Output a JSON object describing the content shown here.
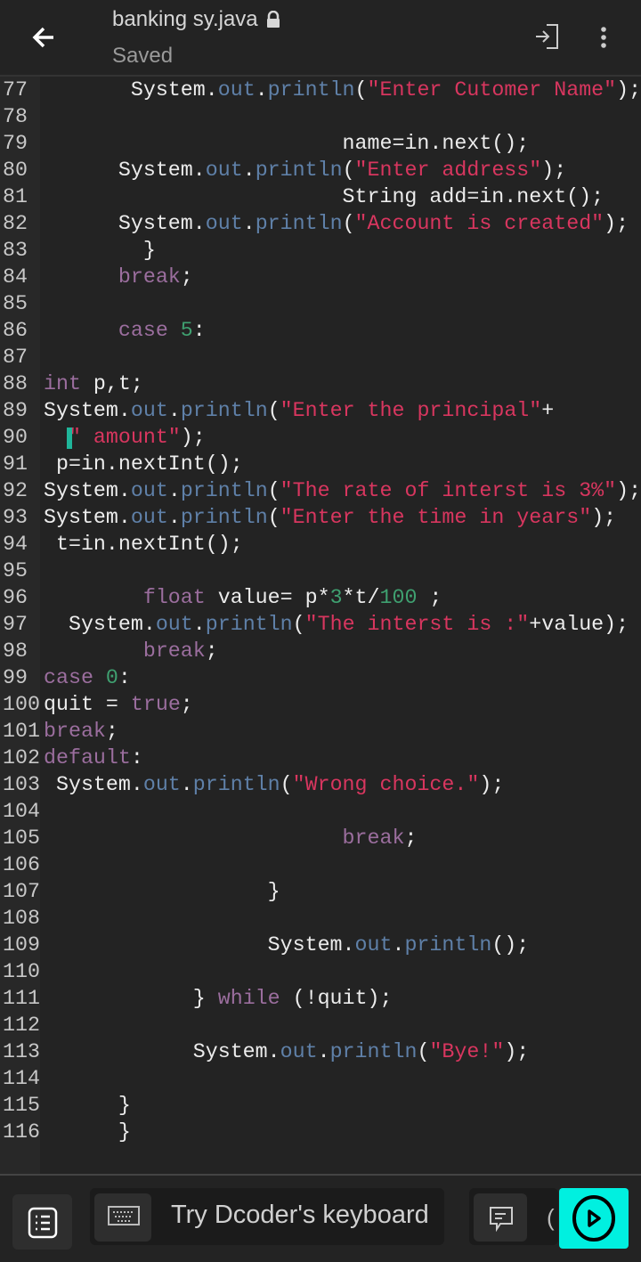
{
  "header": {
    "title": "banking  sy.java",
    "status": "Saved",
    "icons": [
      "back-arrow-icon",
      "lock-icon",
      "exit-icon",
      "more-vert-icon"
    ]
  },
  "colors": {
    "keyword": "#9b6e9e",
    "member": "#5f80a8",
    "string": "#d8365f",
    "number": "#3fa070",
    "run_button": "#00f0e0"
  },
  "editor": {
    "lines": [
      {
        "n": "77",
        "t": [
          [
            "p",
            "       System."
          ],
          [
            "m",
            "out"
          ],
          [
            "p",
            "."
          ],
          [
            "m",
            "println"
          ],
          [
            "p",
            "("
          ],
          [
            "s",
            "\"Enter Cutomer Name\""
          ],
          [
            "p",
            ");"
          ]
        ]
      },
      {
        "n": "78",
        "t": []
      },
      {
        "n": "79",
        "t": [
          [
            "p",
            "                        name=in.next();"
          ]
        ]
      },
      {
        "n": "80",
        "t": [
          [
            "p",
            "      System."
          ],
          [
            "m",
            "out"
          ],
          [
            "p",
            "."
          ],
          [
            "m",
            "println"
          ],
          [
            "p",
            "("
          ],
          [
            "s",
            "\"Enter address\""
          ],
          [
            "p",
            ");"
          ]
        ]
      },
      {
        "n": "81",
        "t": [
          [
            "p",
            "                        String add=in.next();"
          ]
        ]
      },
      {
        "n": "82",
        "t": [
          [
            "p",
            "      System."
          ],
          [
            "m",
            "out"
          ],
          [
            "p",
            "."
          ],
          [
            "m",
            "println"
          ],
          [
            "p",
            "("
          ],
          [
            "s",
            "\"Account is created\""
          ],
          [
            "p",
            ");"
          ]
        ]
      },
      {
        "n": "83",
        "t": [
          [
            "p",
            "        }"
          ]
        ]
      },
      {
        "n": "84",
        "t": [
          [
            "k",
            "      break"
          ],
          [
            "p",
            ";"
          ]
        ]
      },
      {
        "n": "85",
        "t": []
      },
      {
        "n": "86",
        "t": [
          [
            "k",
            "      case "
          ],
          [
            "n",
            "5"
          ],
          [
            "p",
            ":"
          ]
        ]
      },
      {
        "n": "87",
        "t": []
      },
      {
        "n": "88",
        "t": [
          [
            "k",
            "int"
          ],
          [
            "p",
            " p,t;"
          ]
        ]
      },
      {
        "n": "89",
        "t": [
          [
            "p",
            "System."
          ],
          [
            "m",
            "out"
          ],
          [
            "p",
            "."
          ],
          [
            "m",
            "println"
          ],
          [
            "p",
            "("
          ],
          [
            "s",
            "\"Enter the principal\""
          ],
          [
            "p",
            "+"
          ]
        ]
      },
      {
        "n": "90",
        "t": [
          [
            "s",
            "  \" amount\""
          ],
          [
            "p",
            ");"
          ]
        ],
        "cursor": true
      },
      {
        "n": "91",
        "t": [
          [
            "p",
            " p=in.nextInt();"
          ]
        ]
      },
      {
        "n": "92",
        "t": [
          [
            "p",
            "System."
          ],
          [
            "m",
            "out"
          ],
          [
            "p",
            "."
          ],
          [
            "m",
            "println"
          ],
          [
            "p",
            "("
          ],
          [
            "s",
            "\"The rate of interst is 3%\""
          ],
          [
            "p",
            ");"
          ]
        ]
      },
      {
        "n": "93",
        "t": [
          [
            "p",
            "System."
          ],
          [
            "m",
            "out"
          ],
          [
            "p",
            "."
          ],
          [
            "m",
            "println"
          ],
          [
            "p",
            "("
          ],
          [
            "s",
            "\"Enter the time in years\""
          ],
          [
            "p",
            ");"
          ]
        ]
      },
      {
        "n": "94",
        "t": [
          [
            "p",
            " t=in.nextInt();"
          ]
        ]
      },
      {
        "n": "95",
        "t": []
      },
      {
        "n": "96",
        "t": [
          [
            "k",
            "        float"
          ],
          [
            "p",
            " value= p*"
          ],
          [
            "n",
            "3"
          ],
          [
            "p",
            "*t/"
          ],
          [
            "n",
            "100"
          ],
          [
            "p",
            " ;"
          ]
        ]
      },
      {
        "n": "97",
        "t": [
          [
            "p",
            "  System."
          ],
          [
            "m",
            "out"
          ],
          [
            "p",
            "."
          ],
          [
            "m",
            "println"
          ],
          [
            "p",
            "("
          ],
          [
            "s",
            "\"The interst is :\""
          ],
          [
            "p",
            "+value);"
          ]
        ]
      },
      {
        "n": "98",
        "t": [
          [
            "k",
            "        break"
          ],
          [
            "p",
            ";"
          ]
        ]
      },
      {
        "n": "99",
        "t": [
          [
            "k",
            "case "
          ],
          [
            "n",
            "0"
          ],
          [
            "p",
            ":"
          ]
        ]
      },
      {
        "n": "100",
        "t": [
          [
            "p",
            "quit = "
          ],
          [
            "k",
            "true"
          ],
          [
            "p",
            ";"
          ]
        ]
      },
      {
        "n": "101",
        "t": [
          [
            "k",
            "break"
          ],
          [
            "p",
            ";"
          ]
        ]
      },
      {
        "n": "102",
        "t": [
          [
            "k",
            "default"
          ],
          [
            "p",
            ":"
          ]
        ]
      },
      {
        "n": "103",
        "t": [
          [
            "p",
            " System."
          ],
          [
            "m",
            "out"
          ],
          [
            "p",
            "."
          ],
          [
            "m",
            "println"
          ],
          [
            "p",
            "("
          ],
          [
            "s",
            "\"Wrong choice.\""
          ],
          [
            "p",
            ");"
          ]
        ]
      },
      {
        "n": "104",
        "t": []
      },
      {
        "n": "105",
        "t": [
          [
            "k",
            "                        break"
          ],
          [
            "p",
            ";"
          ]
        ]
      },
      {
        "n": "106",
        "t": []
      },
      {
        "n": "107",
        "t": [
          [
            "p",
            "                  }"
          ]
        ]
      },
      {
        "n": "108",
        "t": []
      },
      {
        "n": "109",
        "t": [
          [
            "p",
            "                  System."
          ],
          [
            "m",
            "out"
          ],
          [
            "p",
            "."
          ],
          [
            "m",
            "println"
          ],
          [
            "p",
            "();"
          ]
        ]
      },
      {
        "n": "110",
        "t": []
      },
      {
        "n": "111",
        "t": [
          [
            "p",
            "            } "
          ],
          [
            "k",
            "while"
          ],
          [
            "p",
            " (!quit);"
          ]
        ]
      },
      {
        "n": "112",
        "t": []
      },
      {
        "n": "113",
        "t": [
          [
            "p",
            "            System."
          ],
          [
            "m",
            "out"
          ],
          [
            "p",
            "."
          ],
          [
            "m",
            "println"
          ],
          [
            "p",
            "("
          ],
          [
            "s",
            "\"Bye!\""
          ],
          [
            "p",
            ");"
          ]
        ]
      },
      {
        "n": "114",
        "t": []
      },
      {
        "n": "115",
        "t": [
          [
            "p",
            "      }"
          ]
        ]
      },
      {
        "n": "116",
        "t": [
          [
            "p",
            "      }"
          ]
        ]
      }
    ]
  },
  "bottom": {
    "keyboard_prompt": "Try Dcoder's keyboard",
    "partial_label": "("
  }
}
